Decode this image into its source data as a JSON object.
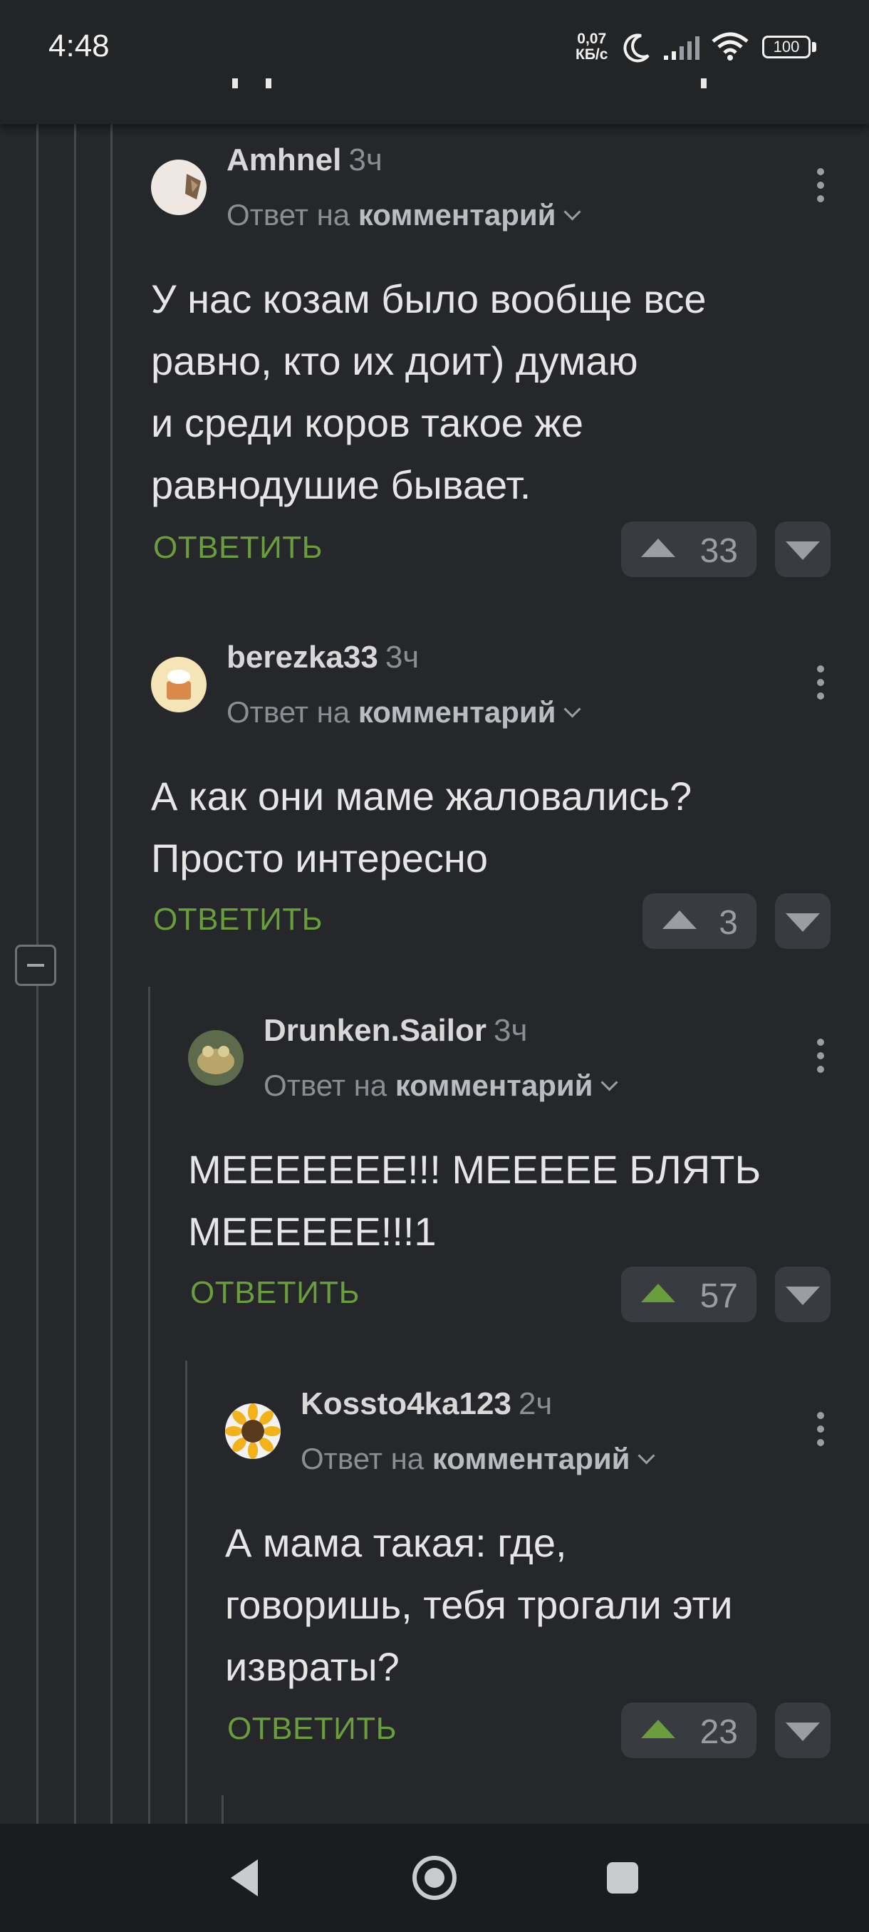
{
  "status_bar": {
    "time": "4:48",
    "speed_value": "0,07",
    "speed_unit": "КБ/с",
    "battery": "100"
  },
  "reply_label": "ОТВЕТИТЬ",
  "comments": [
    {
      "author": "Amhnel",
      "time": "3ч",
      "reply_prefix": "Ответ на",
      "reply_target": "комментарий",
      "lines": [
        "У нас козам было вообще все",
        "равно, кто их доит) думаю",
        "и среди коров такое же",
        "равнодушие бывает."
      ],
      "score": "33",
      "upvoted": false
    },
    {
      "author": "berezka33",
      "time": "3ч",
      "reply_prefix": "Ответ на",
      "reply_target": "комментарий",
      "lines": [
        "А как они маме жаловались?",
        "Просто интересно"
      ],
      "score": "3",
      "upvoted": false
    },
    {
      "author": "Drunken.Sailor",
      "time": "3ч",
      "reply_prefix": "Ответ на",
      "reply_target": "комментарий",
      "lines": [
        "МЕЕЕЕЕЕЕ!!! МЕЕЕЕЕ БЛЯТЬ",
        "МЕЕЕЕЕЕ!!!1"
      ],
      "score": "57",
      "upvoted": true
    },
    {
      "author": "Kossto4ka123",
      "time": "2ч",
      "reply_prefix": "Ответ на",
      "reply_target": "комментарий",
      "lines": [
        "А мама такая: где,",
        "говоришь, тебя трогали эти",
        "извраты?"
      ],
      "score": "23",
      "upvoted": true
    }
  ],
  "colors": {
    "background": "#25272a",
    "accent_green": "#6a9e3c",
    "text": "#e6e6e6",
    "muted": "#8b8f93"
  },
  "icons": [
    "moon-icon",
    "signal-icon",
    "wifi-icon",
    "battery-icon",
    "kebab-menu-icon",
    "upvote-arrow-icon",
    "downvote-arrow-icon",
    "collapse-thread-icon",
    "nav-back-icon",
    "nav-home-icon",
    "nav-recents-icon"
  ]
}
